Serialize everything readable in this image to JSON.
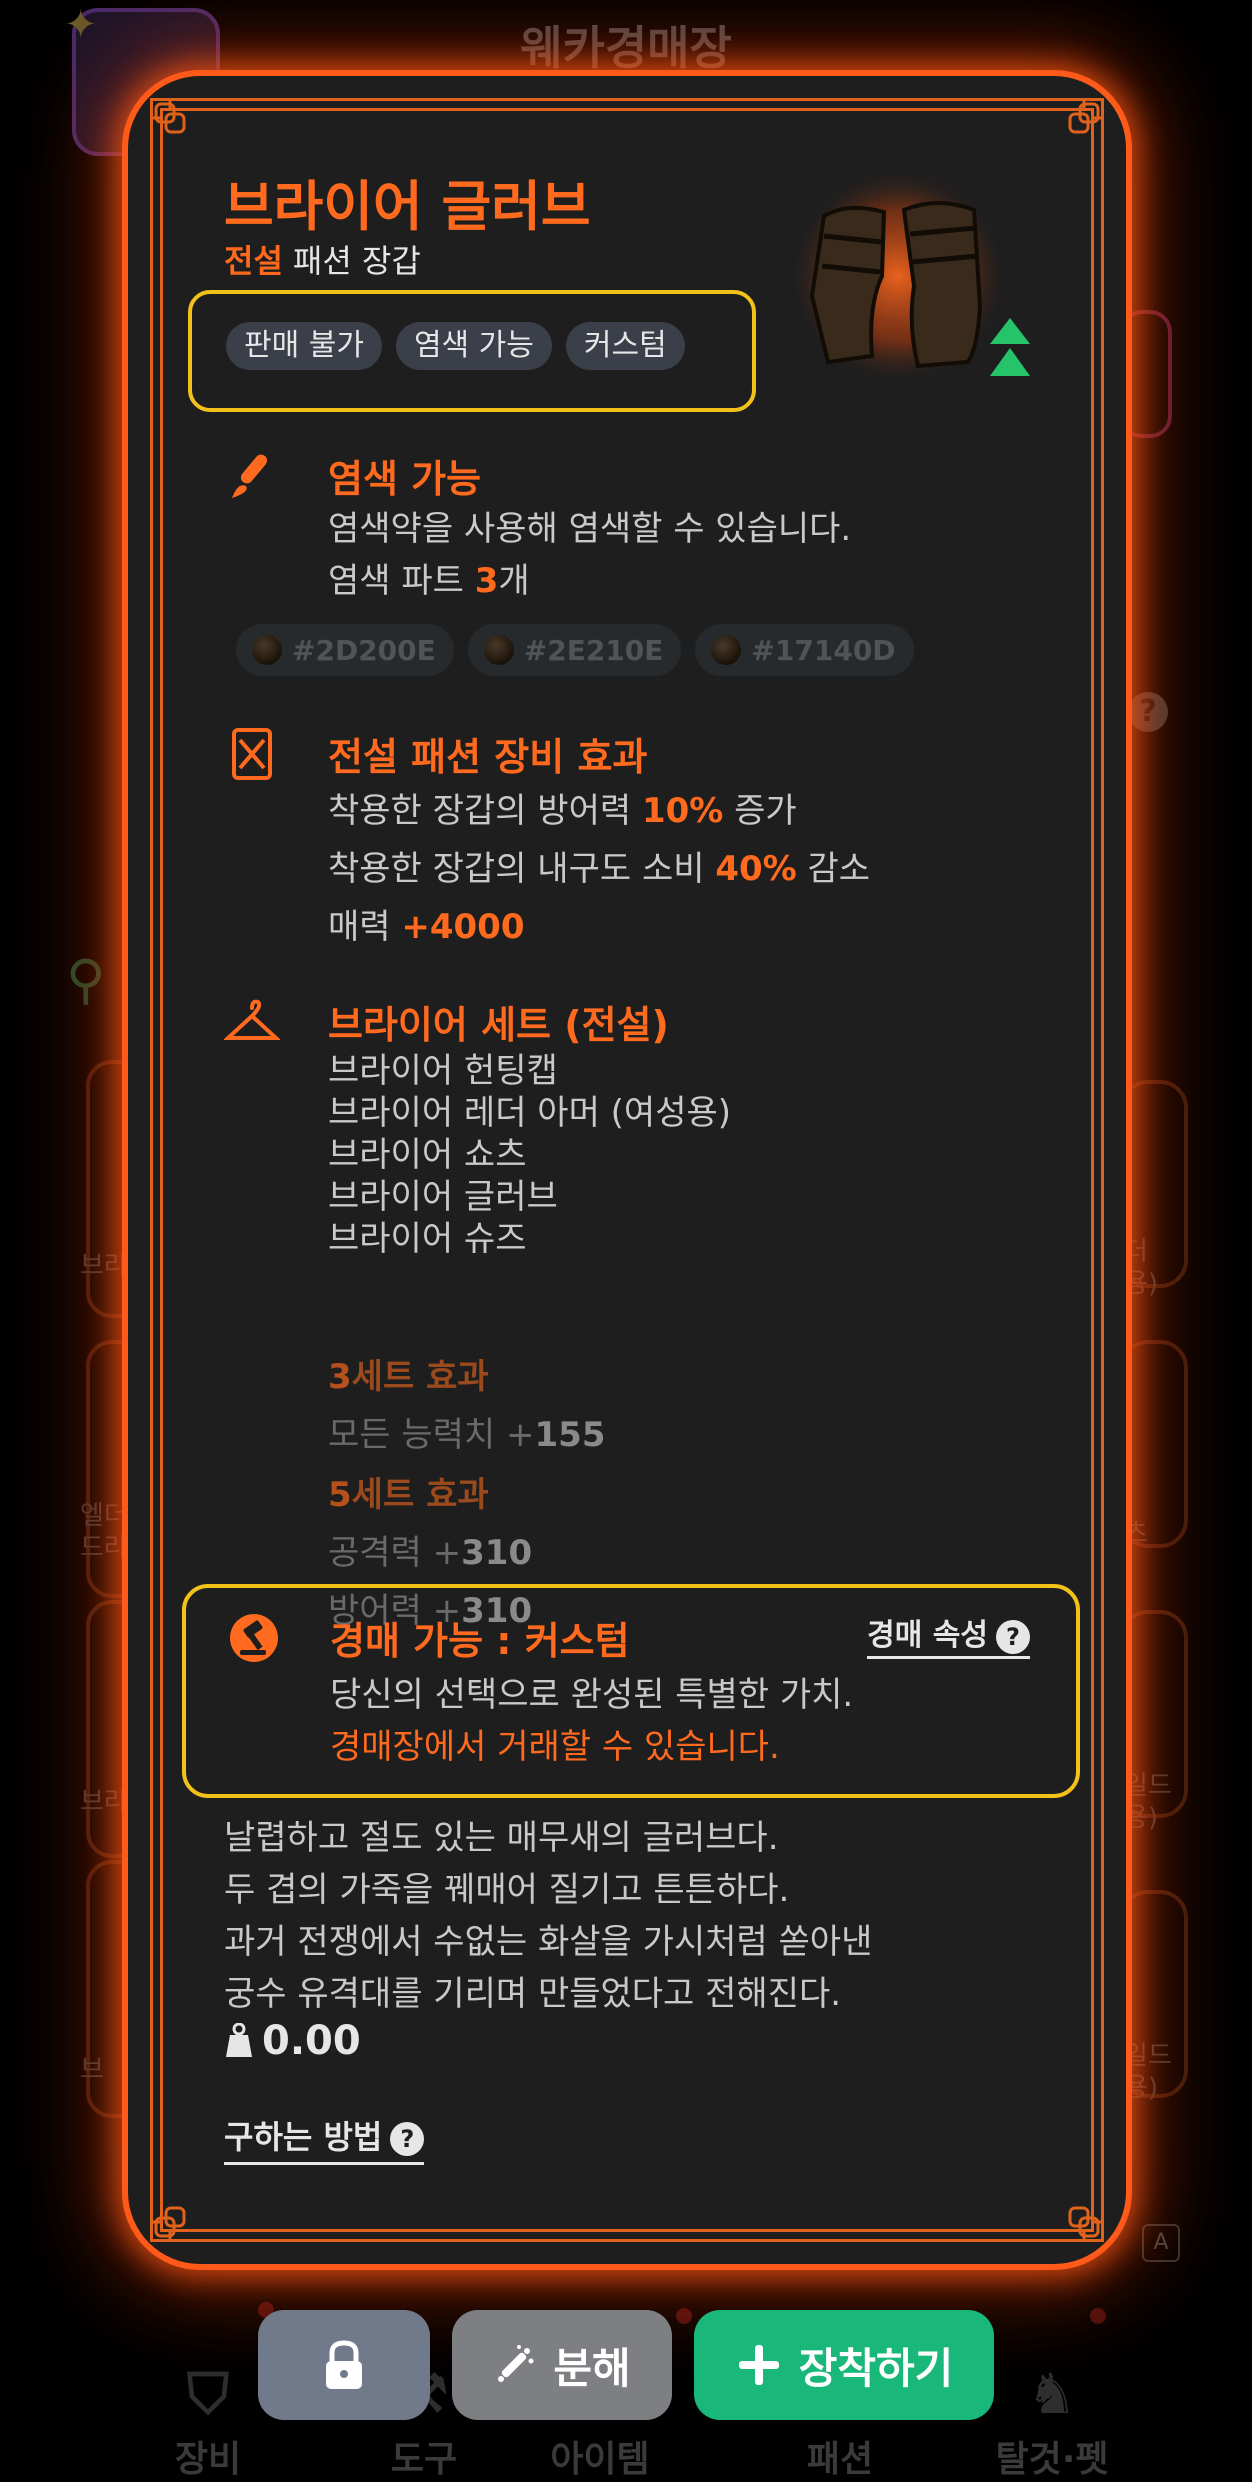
{
  "background": {
    "title": "웨카경매장",
    "help_glyph": "?",
    "a_key": "A",
    "left_labels": [
      "브라",
      "엘더\n드라",
      "브라",
      "브"
    ],
    "right_labels": [
      "더\n용)",
      "츠",
      "일드\n용)",
      "일드\n용)"
    ]
  },
  "bottom_nav": [
    {
      "label": "장비",
      "icon": "armor-icon"
    },
    {
      "label": "도구",
      "icon": "tool-icon"
    },
    {
      "label": "아이템",
      "icon": "item-icon"
    },
    {
      "label": "패션",
      "icon": "fashion-icon"
    },
    {
      "label": "탈것·펫",
      "icon": "pet-icon"
    }
  ],
  "item": {
    "name": "브라이어 글러브",
    "rarity": "전설",
    "category": "패션 장갑",
    "tags": [
      "판매 불가",
      "염색 가능",
      "커스텀"
    ],
    "dye": {
      "title": "염색 가능",
      "desc": "염색약을 사용해 염색할 수 있습니다.",
      "parts_prefix": "염색 파트 ",
      "parts_count": "3",
      "parts_suffix": "개",
      "colors": [
        "#2D200E",
        "#2E210E",
        "#17140D"
      ]
    },
    "fashion_effect": {
      "title": "전설 패션 장비 효과",
      "line1_prefix": "착용한 장갑의 방어력 ",
      "line1_value": "10%",
      "line1_suffix": " 증가",
      "line2_prefix": "착용한 장갑의 내구도 소비 ",
      "line2_value": "40%",
      "line2_suffix": " 감소",
      "line3_prefix": "매력 ",
      "line3_value": "+4000"
    },
    "set": {
      "title": "브라이어 세트 (전설)",
      "pieces": [
        "브라이어 헌팅캡",
        "브라이어 레더 아머 (여성용)",
        "브라이어 쇼츠",
        "브라이어 글러브",
        "브라이어 슈즈"
      ],
      "effects": [
        {
          "count": "3",
          "label": "세트 효과",
          "stat": "모든 능력치 +",
          "value": "155"
        },
        {
          "count": "5",
          "label": "세트 효과",
          "stat": "공격력 +",
          "value": "310"
        },
        {
          "count": "",
          "label": "",
          "stat": "방어력 +",
          "value": "310"
        }
      ]
    },
    "auction": {
      "title": "경매 가능 : 커스텀",
      "link": "경매 속성",
      "line1": "당신의 선택으로 완성된 특별한 가치.",
      "line2": "경매장에서 거래할 수 있습니다."
    },
    "description": [
      "날렵하고 절도 있는 매무새의 글러브다.",
      "두 겹의 가죽을 꿰매어 질기고 튼튼하다.",
      "과거 전쟁에서 수없는 화살을 가시처럼 쏟아낸",
      "궁수 유격대를 기리며 만들었다고 전해진다."
    ],
    "weight": "0.00",
    "how_to_get": "구하는 방법"
  },
  "buttons": {
    "lock_icon": "lock-icon",
    "disassemble": "분해",
    "equip": "장착하기"
  },
  "colors": {
    "accent": "#ff6a1e",
    "highlight_border": "#f2c21a",
    "equip_button": "#19b87a",
    "card_bg": "#1e1e1e"
  }
}
